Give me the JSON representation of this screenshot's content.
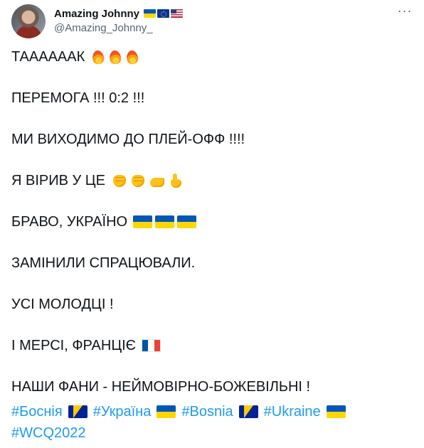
{
  "author": {
    "display_name": "Amazing Johnny",
    "handle": "@Amazing_Johnny_",
    "name_flags": [
      "flag-ukraine",
      "flag-eu",
      "flag-us"
    ]
  },
  "tweet": {
    "lines": [
      {
        "text": "ТААААААК",
        "emojis": [
          "fire-icon",
          "fire-icon",
          "fire-icon"
        ]
      },
      {
        "text": "ПЕРЕМОГА !!! 0:2 !!!",
        "emojis": []
      },
      {
        "text": "МИ ВИХОДИМО ДО ПЛЕЙ-ОФФ !!!!",
        "emojis": []
      },
      {
        "text": "Я ВІРИВ У ЦЕ",
        "emojis": [
          "raised-fist-icon",
          "oncoming-fist-icon",
          "flexed-biceps-icon",
          "thumbs-up-icon"
        ]
      },
      {
        "text": "БРАВО, УКРАЇНО",
        "emojis": [
          "flag-ukraine",
          "flag-ukraine",
          "flag-ukraine"
        ]
      },
      {
        "text": "ЗАМІНИЛИ СПРАЦЮВАЛИ.",
        "emojis": []
      },
      {
        "text": "УСІ МОЛОДЦІ !",
        "emojis": []
      },
      {
        "text": "І МЕРСІ, ФРАНЦІЄ",
        "emojis": [
          "flag-france"
        ]
      },
      {
        "text": "НАШИ ФАНИ - НЕЙМОВІРНО-БОЖЕВІЛЬНІ !",
        "emojis": []
      }
    ],
    "hashtags": [
      {
        "text": "#Боснія",
        "flag": "flag-bosnia"
      },
      {
        "text": "#Україна",
        "flag": "flag-ukraine"
      },
      {
        "text": "#Bosnia",
        "flag": "flag-bosnia"
      },
      {
        "text": "#Ukraine",
        "flag": "flag-ukraine"
      },
      {
        "text": "#WCQ2022",
        "flag": ""
      }
    ]
  },
  "more_menu_label": "···",
  "colors": {
    "link": "#1d9bf0",
    "text": "#0f1419",
    "secondary": "#536471"
  }
}
